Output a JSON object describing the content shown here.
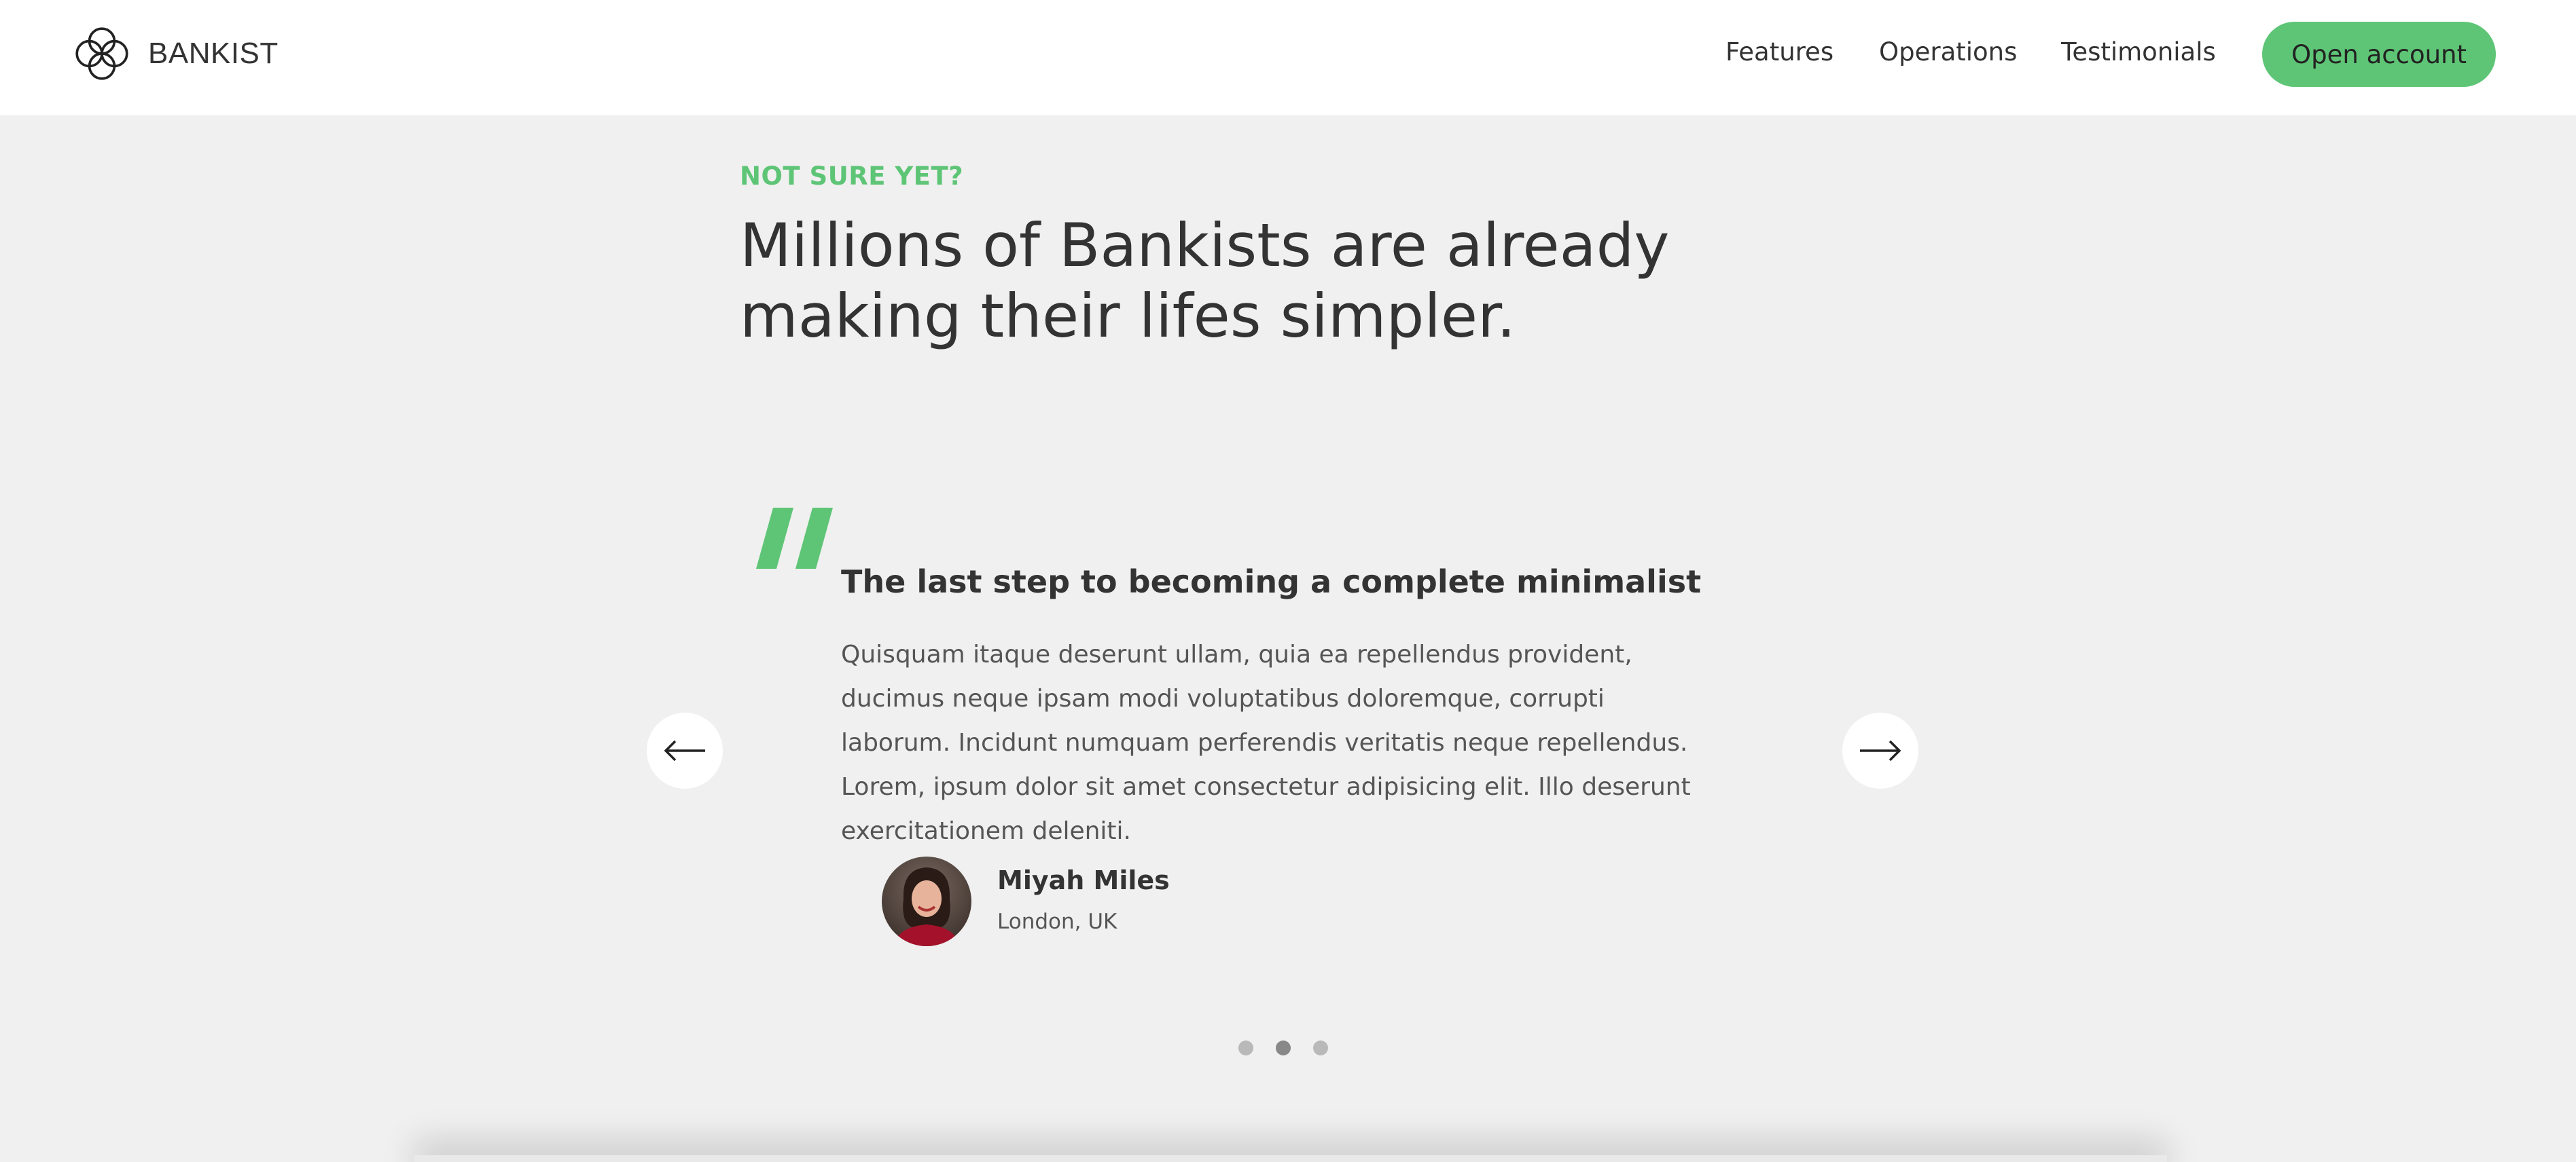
{
  "nav": {
    "brand": "BANKIST",
    "links": [
      "Features",
      "Operations",
      "Testimonials"
    ],
    "cta": "Open account"
  },
  "section": {
    "label": "NOT SURE YET?",
    "title": "Millions of Bankists are already making their lifes simpler."
  },
  "testimonial": {
    "heading": "The last step to becoming a complete minimalist",
    "text": "Quisquam itaque deserunt ullam, quia ea repellendus provident, ducimus neque ipsam modi voluptatibus doloremque, corrupti laborum. Incidunt numquam perferendis veritatis neque repellendus. Lorem, ipsum dolor sit amet consectetur adipisicing elit. Illo deserunt exercitationem deleniti.",
    "author": "Miyah Miles",
    "location": "London, UK"
  },
  "slider": {
    "dots": 3,
    "active_index": 1
  },
  "colors": {
    "accent": "#5ec576",
    "background": "#f0f0f0",
    "text": "#333333"
  }
}
